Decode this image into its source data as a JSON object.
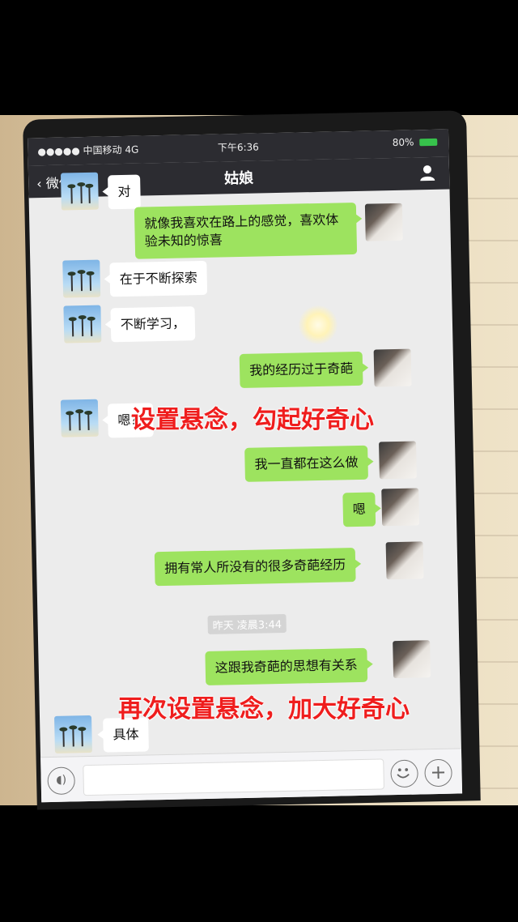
{
  "status_bar": {
    "carrier": "●●●●● 中国移动  4G",
    "time": "下午6:36",
    "battery": "80%"
  },
  "nav": {
    "back_label": "微信",
    "title": "姑娘"
  },
  "messages": [
    {
      "from": "other",
      "text": "对"
    },
    {
      "from": "me",
      "text": "就像我喜欢在路上的感觉，喜欢体验未知的惊喜"
    },
    {
      "from": "other",
      "text": "在于不断探索"
    },
    {
      "from": "other",
      "text": "不断学习，"
    },
    {
      "from": "me",
      "text": "我的经历过于奇葩"
    },
    {
      "from": "other",
      "text": "嗯？"
    },
    {
      "from": "me",
      "text": "我一直都在这么做"
    },
    {
      "from": "me",
      "text": "嗯"
    },
    {
      "from": "me",
      "text": "拥有常人所没有的很多奇葩经历"
    },
    {
      "from": "me",
      "text": "这跟我奇葩的思想有关系"
    },
    {
      "from": "other",
      "text": "具体"
    }
  ],
  "timestamp": "昨天 凌晨3:44",
  "annotations": [
    "设置悬念，勾起好奇心",
    "再次设置悬念，加大好奇心"
  ],
  "colors": {
    "bubble_me": "#9de35f",
    "bubble_other": "#ffffff",
    "annotation": "#ef1d1d"
  }
}
